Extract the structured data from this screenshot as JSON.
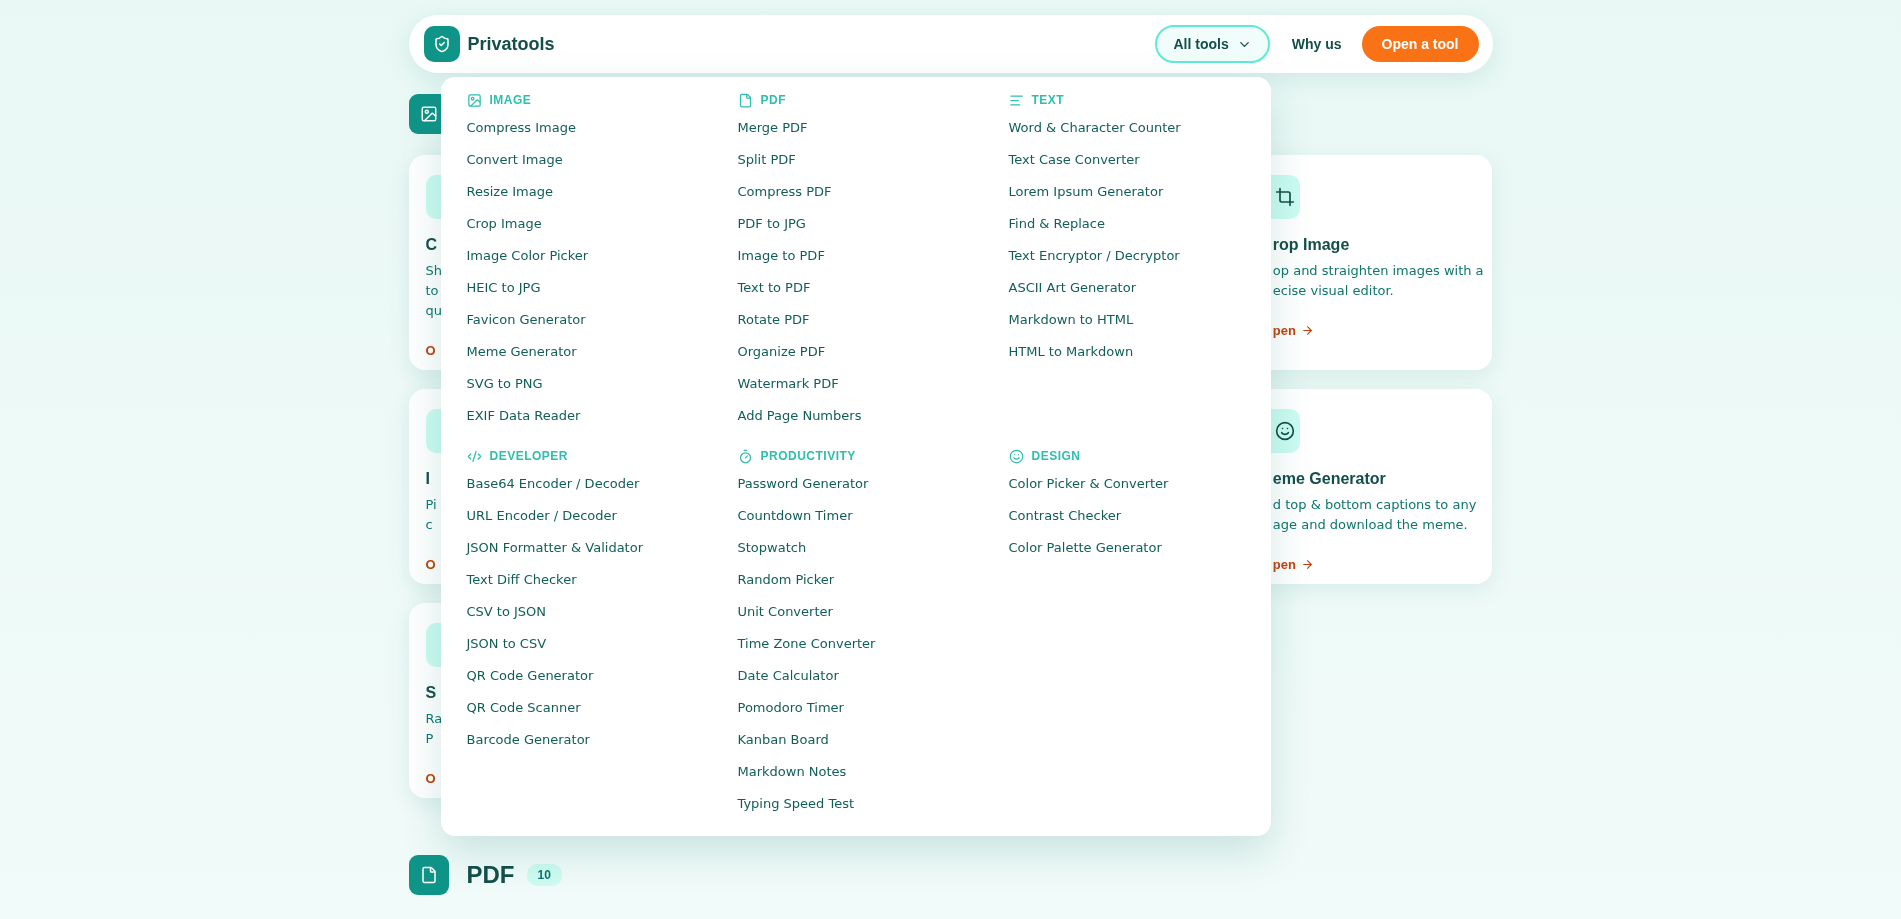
{
  "header": {
    "brand": "Privatools",
    "nav": [
      {
        "label": "All tools",
        "kind": "dropdown",
        "selected": true
      },
      {
        "label": "Why us",
        "kind": "link",
        "selected": false
      }
    ],
    "cta": "Open a tool"
  },
  "card_rows": [
    [
      {
        "kind": "clipped",
        "title": "C",
        "description": [
          "Sh",
          "to",
          "qu"
        ],
        "link": "O"
      },
      {
        "kind": "crop",
        "title": "rop Image",
        "description": [
          "op and straighten images with a",
          "ecise visual editor."
        ],
        "link": "pen"
      }
    ],
    [
      {
        "kind": "clipped",
        "title": "I",
        "description": [
          "Pi",
          "c"
        ],
        "link": "O"
      },
      {
        "kind": "smile",
        "title": "eme Generator",
        "description": [
          "d top & bottom captions to any",
          "age and download the meme."
        ],
        "link": "pen"
      }
    ],
    [
      {
        "kind": "clipped",
        "title": "S",
        "description": [
          "Ra",
          "P"
        ],
        "link": "O"
      }
    ]
  ],
  "menu": {
    "groups": [
      {
        "kind": "image",
        "title": "IMAGE",
        "items": [
          "Compress Image",
          "Convert Image",
          "Resize Image",
          "Crop Image",
          "Image Color Picker",
          "HEIC to JPG",
          "Favicon Generator",
          "Meme Generator",
          "SVG to PNG",
          "EXIF Data Reader"
        ]
      },
      {
        "kind": "pdf",
        "title": "PDF",
        "items": [
          "Merge PDF",
          "Split PDF",
          "Compress PDF",
          "PDF to JPG",
          "Image to PDF",
          "Text to PDF",
          "Rotate PDF",
          "Organize PDF",
          "Watermark PDF",
          "Add Page Numbers"
        ]
      },
      {
        "kind": "text",
        "title": "TEXT",
        "items": [
          "Word & Character Counter",
          "Text Case Converter",
          "Lorem Ipsum Generator",
          "Find & Replace",
          "Text Encryptor / Decryptor",
          "ASCII Art Generator",
          "Markdown to HTML",
          "HTML to Markdown"
        ]
      },
      {
        "kind": "developer",
        "title": "DEVELOPER",
        "items": [
          "Base64 Encoder / Decoder",
          "URL Encoder / Decoder",
          "JSON Formatter & Validator",
          "Text Diff Checker",
          "CSV to JSON",
          "JSON to CSV",
          "QR Code Generator",
          "QR Code Scanner",
          "Barcode Generator"
        ]
      },
      {
        "kind": "productivity",
        "title": "PRODUCTIVITY",
        "items": [
          "Password Generator",
          "Countdown Timer",
          "Stopwatch",
          "Random Picker",
          "Unit Converter",
          "Time Zone Converter",
          "Date Calculator",
          "Pomodoro Timer",
          "Kanban Board",
          "Markdown Notes",
          "Typing Speed Test"
        ]
      },
      {
        "kind": "design",
        "title": "DESIGN",
        "items": [
          "Color Picker & Converter",
          "Contrast Checker",
          "Color Palette Generator"
        ]
      }
    ]
  },
  "next_section": {
    "title": "PDF",
    "count": "10"
  }
}
